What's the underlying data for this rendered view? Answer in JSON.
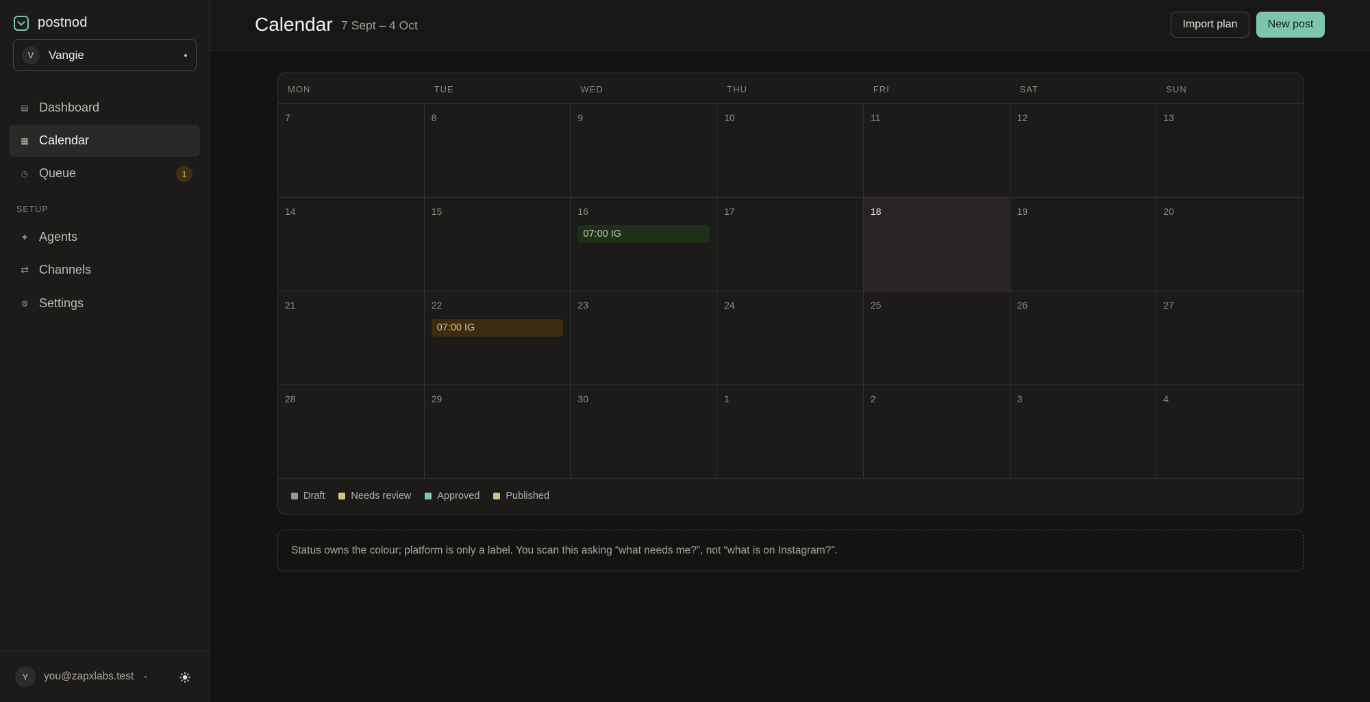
{
  "brand": {
    "name": "postnod",
    "icon": "check-square-icon",
    "accent": "#7fc4ad"
  },
  "workspace": {
    "initial": "V",
    "name": "Vangie"
  },
  "nav": {
    "items": [
      {
        "label": "Dashboard",
        "icon": "grid-icon"
      },
      {
        "label": "Calendar",
        "icon": "calendar-icon",
        "active": true
      },
      {
        "label": "Queue",
        "icon": "clock-icon",
        "badge": "1"
      }
    ],
    "setup_label": "SETUP",
    "setup_items": [
      {
        "label": "Agents",
        "icon": "sparkle-icon"
      },
      {
        "label": "Channels",
        "icon": "arrows-icon"
      },
      {
        "label": "Settings",
        "icon": "gear-icon"
      }
    ]
  },
  "user": {
    "initial": "Y",
    "email": "you@zapxlabs.test"
  },
  "header": {
    "title": "Calendar",
    "date_range": "7 Sept – 4 Oct",
    "import_label": "Import plan",
    "new_post_label": "New post"
  },
  "calendar": {
    "weekdays": [
      "MON",
      "TUE",
      "WED",
      "THU",
      "FRI",
      "SAT",
      "SUN"
    ],
    "days": [
      "7",
      "8",
      "9",
      "10",
      "11",
      "12",
      "13",
      "14",
      "15",
      "16",
      "17",
      "18",
      "19",
      "20",
      "21",
      "22",
      "23",
      "24",
      "25",
      "26",
      "27",
      "28",
      "29",
      "30",
      "1",
      "2",
      "3",
      "4"
    ],
    "today_index": 11,
    "events": [
      {
        "day_index": 9,
        "label": "07:00 IG",
        "status": "approved"
      },
      {
        "day_index": 15,
        "label": "07:00 IG",
        "status": "needs_review"
      }
    ],
    "legend": [
      {
        "label": "Draft",
        "color": "#9a9792"
      },
      {
        "label": "Needs review",
        "color": "#d9c27a"
      },
      {
        "label": "Approved",
        "color": "#86c7b3"
      },
      {
        "label": "Published",
        "color": "#c5c487"
      }
    ],
    "status_colors": {
      "approved": {
        "bg": "#1f3019",
        "fg": "#b6c9a6"
      },
      "needs_review": {
        "bg": "#3c2c10",
        "fg": "#e3c17f"
      }
    }
  },
  "note": "Status owns the colour; platform is only a label. You scan this asking “what needs me?”, not “what is on Instagram?”."
}
